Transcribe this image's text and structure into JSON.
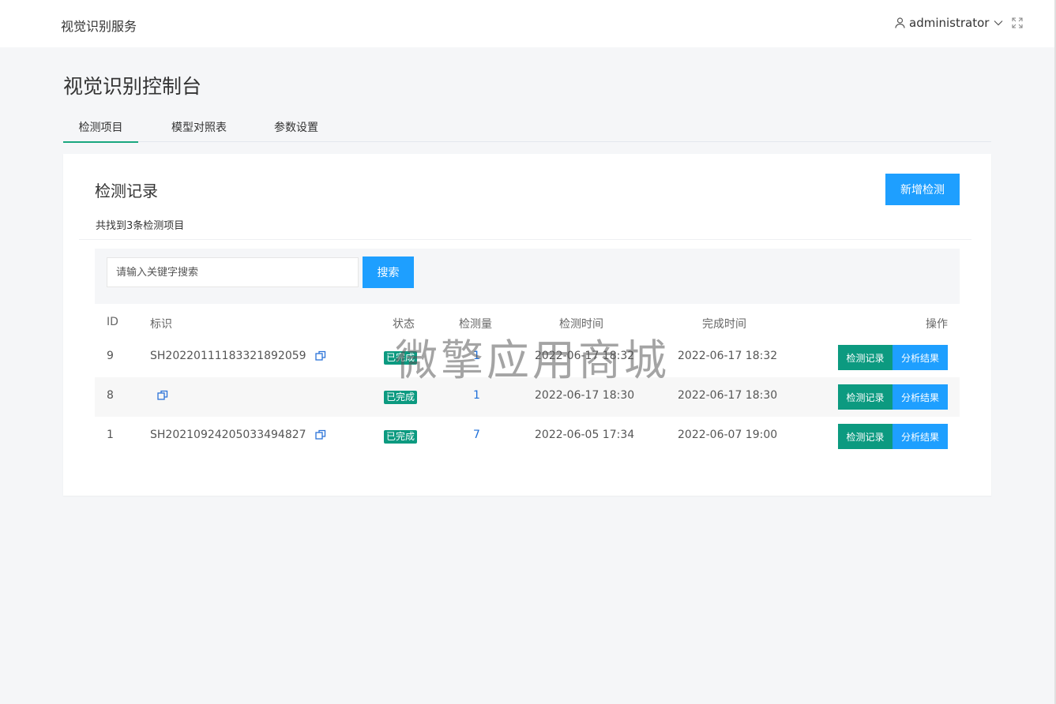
{
  "app": {
    "title": "视觉识别服务"
  },
  "header": {
    "user_name": "administrator"
  },
  "page": {
    "title": "视觉识别控制台"
  },
  "tabs": [
    {
      "label": "检测项目",
      "active": true
    },
    {
      "label": "模型对照表",
      "active": false
    },
    {
      "label": "参数设置",
      "active": false
    }
  ],
  "card": {
    "title": "检测记录",
    "summary": "共找到3条检测项目",
    "add_button": "新增检测"
  },
  "search": {
    "placeholder": "请输入关键字搜索",
    "value": "",
    "button": "搜索"
  },
  "table": {
    "columns": [
      "ID",
      "标识",
      "状态",
      "检测量",
      "检测时间",
      "完成时间",
      "操作"
    ],
    "rows": [
      {
        "id": "9",
        "ident": "SH2022011118332189205​9",
        "status": "已完成",
        "count": "1",
        "detect_time": "2022-06-17 18:32",
        "finish_time": "2022-06-17 18:32",
        "action_record": "检测记录",
        "action_result": "分析结果"
      },
      {
        "id": "8",
        "ident": "",
        "status": "已完成",
        "count": "1",
        "detect_time": "2022-06-17 18:30",
        "finish_time": "2022-06-17 18:30",
        "action_record": "检测记录",
        "action_result": "分析结果"
      },
      {
        "id": "1",
        "ident": "SH20210924205033494827",
        "status": "已完成",
        "count": "7",
        "detect_time": "2022-06-05 17:34",
        "finish_time": "2022-06-07 19:00",
        "action_record": "检测记录",
        "action_result": "分析结果"
      }
    ]
  },
  "watermark": "微擎应用商城",
  "colors": {
    "primary": "#1e9fff",
    "success": "#0c9a80",
    "tab_indicator": "#1aa77f"
  },
  "icons": {
    "user": "user-icon",
    "chevron": "chevron-down-icon",
    "fullscreen": "fullscreen-icon",
    "copy": "copy-icon"
  }
}
